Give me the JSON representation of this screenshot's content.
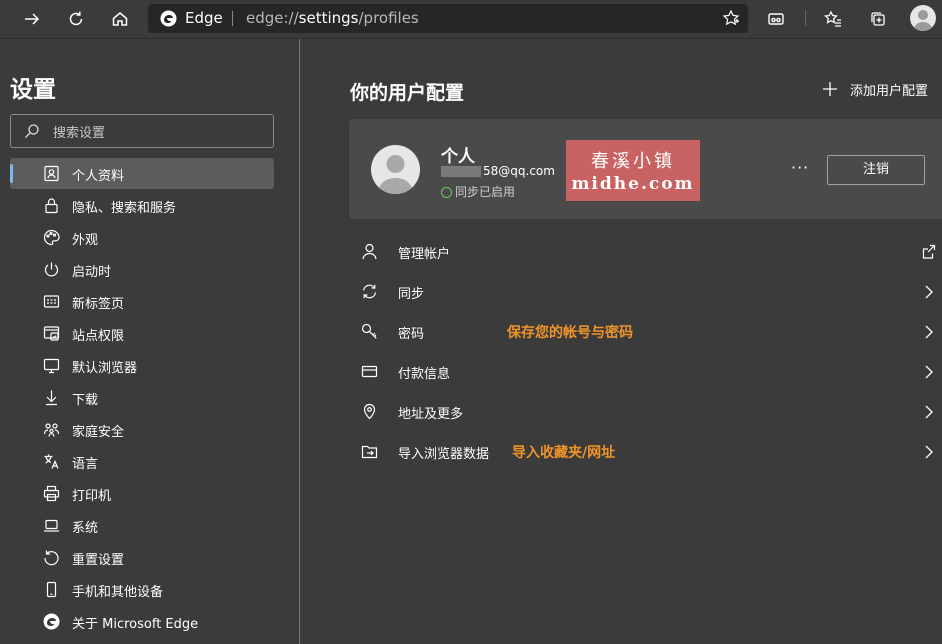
{
  "browser": {
    "brand": "Edge",
    "url_prefix": "edge://",
    "url_host": "settings",
    "url_path": "/profiles",
    "icons": [
      "forward-icon",
      "refresh-icon",
      "home-icon",
      "edge-logo-icon",
      "favorite-star-icon",
      "immersive-reader-icon",
      "favorites-icon",
      "collections-icon",
      "profile-avatar-icon"
    ]
  },
  "sidebar": {
    "title": "设置",
    "search_placeholder": "搜索设置",
    "items": [
      {
        "label": "个人资料",
        "icon": "profile-card-icon",
        "active": true
      },
      {
        "label": "隐私、搜索和服务",
        "icon": "lock-icon"
      },
      {
        "label": "外观",
        "icon": "palette-icon"
      },
      {
        "label": "启动时",
        "icon": "power-icon"
      },
      {
        "label": "新标签页",
        "icon": "new-tab-icon"
      },
      {
        "label": "站点权限",
        "icon": "site-permissions-icon"
      },
      {
        "label": "默认浏览器",
        "icon": "default-browser-icon"
      },
      {
        "label": "下载",
        "icon": "download-icon"
      },
      {
        "label": "家庭安全",
        "icon": "family-icon"
      },
      {
        "label": "语言",
        "icon": "language-icon"
      },
      {
        "label": "打印机",
        "icon": "printer-icon"
      },
      {
        "label": "系统",
        "icon": "laptop-icon"
      },
      {
        "label": "重置设置",
        "icon": "reset-icon"
      },
      {
        "label": "手机和其他设备",
        "icon": "phone-icon"
      },
      {
        "label": "关于 Microsoft Edge",
        "icon": "edge-logo-icon"
      }
    ]
  },
  "main": {
    "title": "你的用户配置",
    "add_profile": "添加用户配置",
    "profile": {
      "name": "个人",
      "email_visible": "58@qq.com",
      "sync_status": "同步已启用",
      "more": "···",
      "sign_out": "注销"
    },
    "watermark": {
      "line1": "春溪小镇",
      "line2": "midhe.com",
      "color": "#c96363"
    },
    "rows": [
      {
        "label": "管理帐户",
        "icon": "person-icon",
        "trail": "external-link-icon"
      },
      {
        "label": "同步",
        "icon": "sync-icon",
        "trail": "chevron-right-icon"
      },
      {
        "label": "密码",
        "icon": "key-icon",
        "trail": "chevron-right-icon",
        "note": "保存您的帐号与密码"
      },
      {
        "label": "付款信息",
        "icon": "card-icon",
        "trail": "chevron-right-icon"
      },
      {
        "label": "地址及更多",
        "icon": "location-pin-icon",
        "trail": "chevron-right-icon"
      },
      {
        "label": "导入浏览器数据",
        "icon": "import-icon",
        "trail": "chevron-right-icon",
        "note": "导入收藏夹/网址"
      }
    ]
  },
  "colors": {
    "background": "#3b3b3b",
    "card": "#4a4a4a",
    "active_item": "#5c5c5c",
    "accent_bar": "#7fb8f0",
    "annotation": "#f0942a",
    "sync_ok": "#6ccb5f"
  }
}
